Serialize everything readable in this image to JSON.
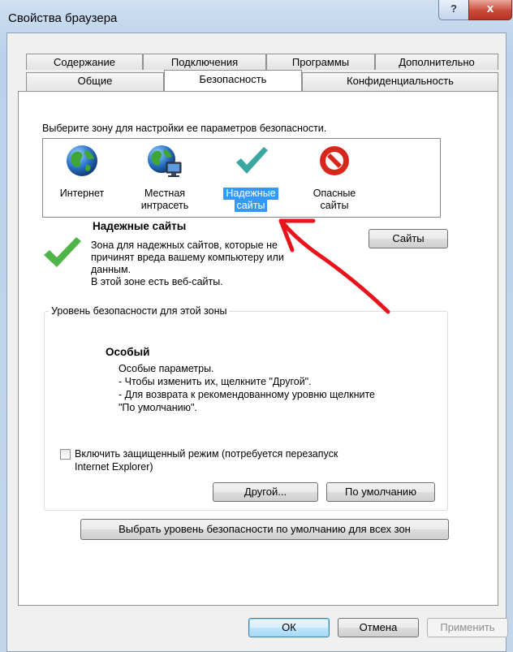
{
  "window": {
    "title": "Свойства браузера",
    "help_glyph": "?",
    "close_glyph": "x"
  },
  "tabs_row1": [
    {
      "label": "Содержание"
    },
    {
      "label": "Подключения"
    },
    {
      "label": "Программы"
    },
    {
      "label": "Дополнительно"
    }
  ],
  "tabs_row2": [
    {
      "label": "Общие"
    },
    {
      "label": "Безопасность",
      "active": true
    },
    {
      "label": "Конфиденциальность"
    }
  ],
  "security": {
    "instruction": "Выберите зону для настройки ее параметров безопасности.",
    "zones": [
      {
        "line1": "Интернет",
        "line2": "",
        "icon": "globe-icon"
      },
      {
        "line1": "Местная",
        "line2": "интрасеть",
        "icon": "intranet-globe-icon"
      },
      {
        "line1": "Надежные",
        "line2": "сайты",
        "icon": "checkmark-icon",
        "selected": true
      },
      {
        "line1": "Опасные",
        "line2": "сайты",
        "icon": "forbidden-icon"
      }
    ],
    "zone_title": "Надежные сайты",
    "zone_desc_lines": [
      "Зона для надежных сайтов, которые не",
      "причинят вреда вашему компьютеру или",
      "данным.",
      "В этой зоне есть веб-сайты."
    ],
    "sites_button": "Сайты",
    "level_group_title": "Уровень безопасности для этой зоны",
    "level_name": "Особый",
    "level_lines": [
      "Особые параметры.",
      "- Чтобы изменить их, щелкните \"Другой\".",
      "- Для возврата к рекомендованному уровню щелкните",
      "\"По умолчанию\"."
    ],
    "protected_mode_line1": "Включить защищенный режим (потребуется перезапуск",
    "protected_mode_line2": "Internet Explorer)",
    "protected_mode_checked": false,
    "custom_button": "Другой...",
    "default_button": "По умолчанию",
    "reset_all_button": "Выбрать уровень безопасности по умолчанию для всех зон"
  },
  "footer": {
    "ok": "ОК",
    "cancel": "Отмена",
    "apply": "Применить"
  },
  "colors": {
    "selection": "#3399ff",
    "annotation_arrow": "#e8141b",
    "check_green": "#3aa63a",
    "forbidden_red": "#d8261c"
  }
}
